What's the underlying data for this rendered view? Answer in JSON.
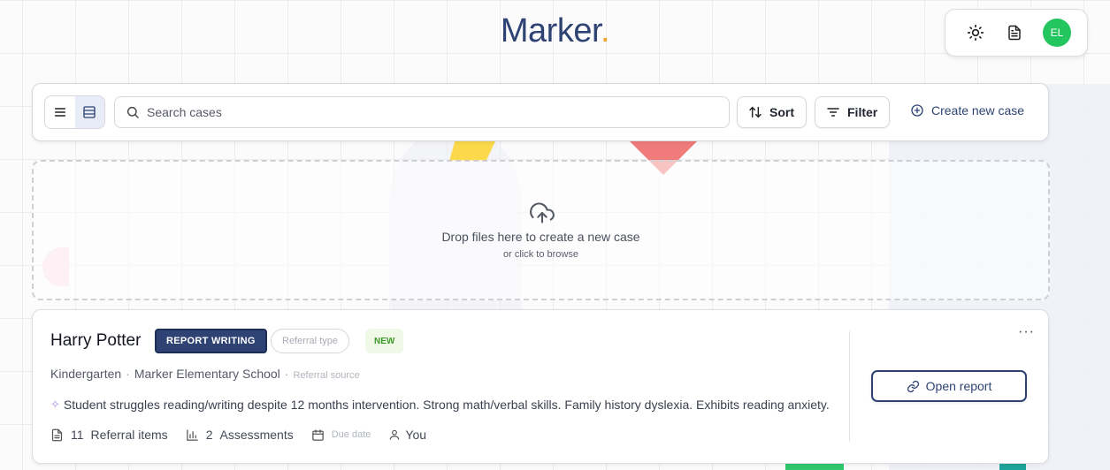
{
  "app": {
    "logo_text": "Marker",
    "logo_dot": "."
  },
  "top_actions": {
    "theme_icon": "sun-icon",
    "doc_icon": "document-icon",
    "avatar_initials": "EL",
    "avatar_color": "#22c55e"
  },
  "toolbar": {
    "search_placeholder": "Search cases",
    "sort_label": "Sort",
    "filter_label": "Filter",
    "create_label": "Create new case",
    "active_view": "table"
  },
  "dropzone": {
    "title": "Drop files here to create a new case",
    "subtitle": "or click to browse"
  },
  "case": {
    "name": "Harry Potter",
    "status_badge": "REPORT WRITING",
    "referral_type": "Referral type",
    "new_badge": "NEW",
    "grade": "Kindergarten",
    "school": "Marker Elementary School",
    "referral_source": "Referral source",
    "separator": "·",
    "summary": "Student struggles reading/writing despite 12 months intervention. Strong math/verbal skills. Family history dyslexia. Exhibits reading anxiety.",
    "referral_items_count": "11",
    "referral_items_label": "Referral items",
    "assessments_count": "2",
    "assessments_label": "Assessments",
    "due_date": "Due date",
    "assignee": "You",
    "open_label": "Open report",
    "more_label": "···"
  },
  "colors": {
    "brand_navy": "#2e4373",
    "logo_dot": "#f2a52a",
    "new_badge_text": "#3a9a28"
  }
}
